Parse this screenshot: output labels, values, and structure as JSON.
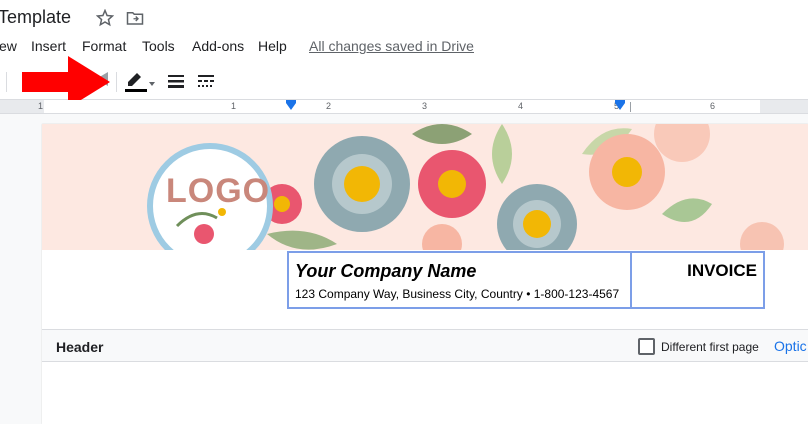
{
  "title_bar": {
    "doc_title": "Template"
  },
  "menu": {
    "items": [
      {
        "label": "ew"
      },
      {
        "label": "Insert"
      },
      {
        "label": "Format"
      },
      {
        "label": "Tools"
      },
      {
        "label": "Add-ons"
      },
      {
        "label": "Help"
      }
    ],
    "saved_status": "All changes saved in Drive"
  },
  "toolbar": {
    "pen_color": "#000000",
    "annotation_arrow_color": "#ff0000",
    "icons": [
      "border-color-pen-icon",
      "border-width-icon",
      "border-dash-icon"
    ]
  },
  "ruler": {
    "numbers": [
      "1",
      "1",
      "2",
      "3",
      "4",
      "5",
      "6"
    ]
  },
  "document": {
    "banner": {
      "logo_text": "LOGO"
    },
    "company_name": "Your Company Name",
    "company_address": "123 Company Way, Business City, Country • 1-800-123-4567",
    "invoice_label": "INVOICE"
  },
  "header_bar": {
    "label": "Header",
    "different_first_page": "Different first page",
    "different_first_page_checked": false,
    "options": "Optic"
  },
  "colors": {
    "accent": "#1a73e8",
    "table_border": "#7c9ee8",
    "banner_bg": "#fde8e1"
  }
}
